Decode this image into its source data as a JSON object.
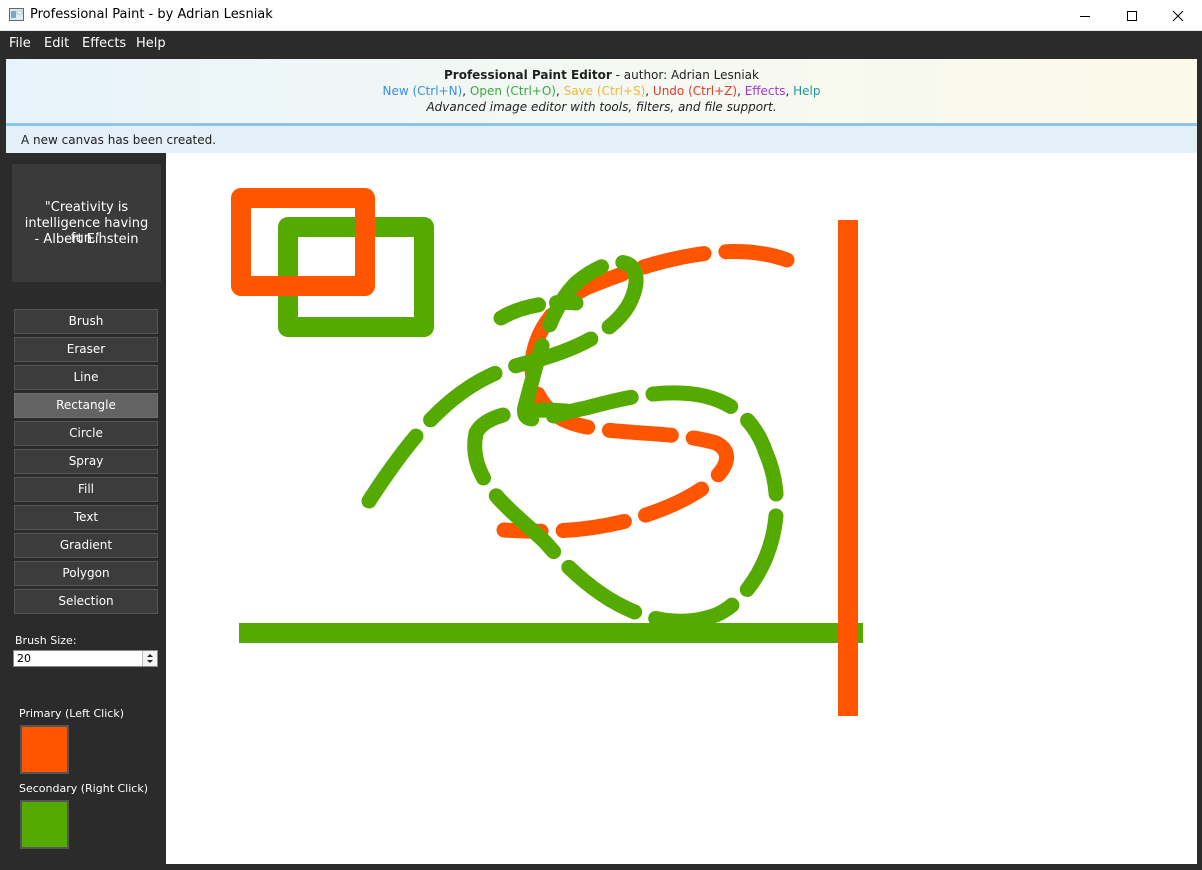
{
  "window": {
    "title": "Professional Paint - by Adrian Lesniak"
  },
  "menu": [
    "File",
    "Edit",
    "Effects",
    "Help"
  ],
  "header": {
    "app_name": "Professional Paint Editor",
    "author_text": " - author: Adrian Lesniak",
    "shortcuts": [
      {
        "label": "New (Ctrl+N)",
        "color": "#3a8ee6"
      },
      {
        "label": "Open (Ctrl+O)",
        "color": "#3aa843"
      },
      {
        "label": "Save (Ctrl+S)",
        "color": "#f0b63a"
      },
      {
        "label": "Undo (Ctrl+Z)",
        "color": "#e03a2a"
      },
      {
        "label": "Effects",
        "color": "#9b3ad0"
      },
      {
        "label": "Help",
        "color": "#1a9a9a"
      }
    ],
    "tagline": "Advanced image editor with tools, filters, and file support."
  },
  "status": "A new canvas has been created.",
  "quote": {
    "line1": "\"Creativity is",
    "line2": "intelligence having fun.\"",
    "line3": "- Albert Einstein"
  },
  "tools": [
    "Brush",
    "Eraser",
    "Line",
    "Rectangle",
    "Circle",
    "Spray",
    "Fill",
    "Text",
    "Gradient",
    "Polygon",
    "Selection"
  ],
  "active_tool": "Rectangle",
  "brush": {
    "label": "Brush Size:",
    "value": "20"
  },
  "colors": {
    "primary_label": "Primary (Left Click)",
    "primary": "#ff5500",
    "secondary_label": "Secondary (Right Click)",
    "secondary": "#55aa00"
  }
}
